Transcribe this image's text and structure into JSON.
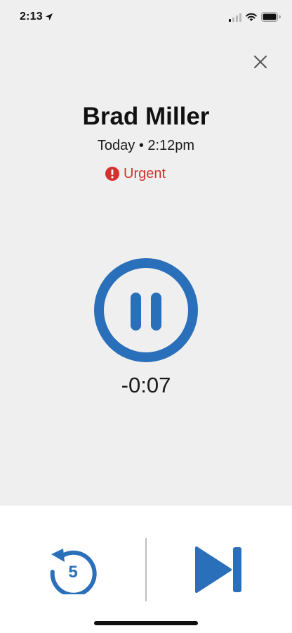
{
  "status_bar": {
    "time": "2:13",
    "icons": [
      "location-arrow-icon",
      "cellular-signal-icon",
      "wifi-icon",
      "battery-icon"
    ]
  },
  "voicemail": {
    "caller_name": "Brad Miller",
    "timestamp": "Today • 2:12pm",
    "priority_label": "Urgent",
    "remaining_time": "-0:07"
  },
  "controls": {
    "replay_seconds": "5",
    "icons": {
      "close": "close-icon",
      "pause": "pause-icon",
      "replay": "replay-5-icon",
      "skip": "skip-next-icon"
    }
  },
  "colors": {
    "accent": "#2a6fba",
    "urgent": "#d6302f",
    "background": "#efeff0",
    "panel": "#ffffff"
  }
}
